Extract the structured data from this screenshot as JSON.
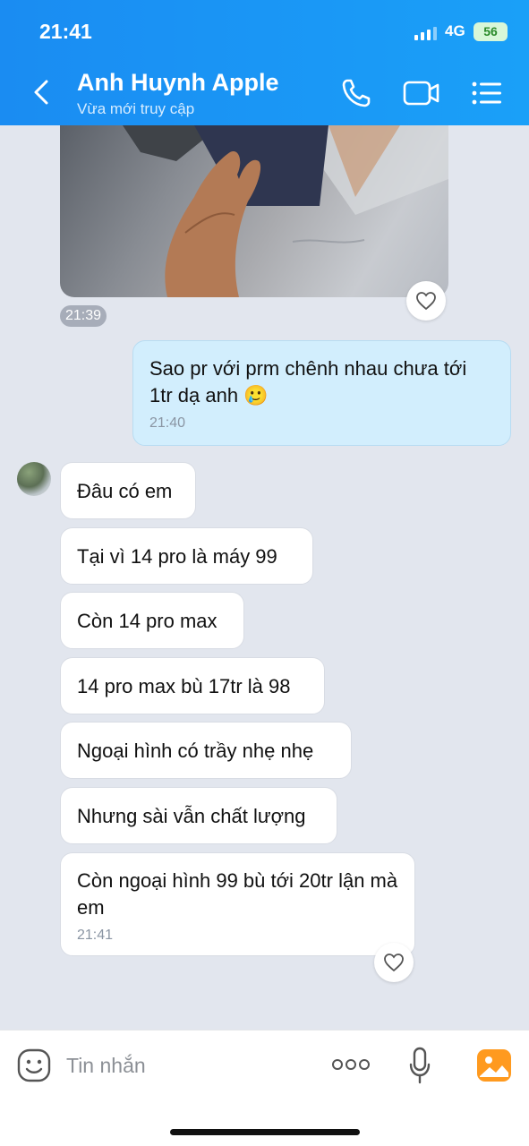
{
  "status_bar": {
    "time": "21:41",
    "network": "4G",
    "battery": "56"
  },
  "header": {
    "title": "Anh Huynh Apple",
    "subtitle": "Vừa mới truy cập"
  },
  "photo_message": {
    "time": "21:39"
  },
  "outgoing": {
    "text": "Sao pr với prm chênh nhau chưa tới 1tr dạ anh 🥲",
    "time": "21:40"
  },
  "incoming": [
    {
      "text": "Đâu có em"
    },
    {
      "text": "Tại vì 14 pro là máy 99"
    },
    {
      "text": "Còn 14 pro max"
    },
    {
      "text": "14 pro max bù 17tr là 98"
    },
    {
      "text": "Ngoại hình có trầy nhẹ nhẹ"
    },
    {
      "text": "Nhưng sài vẫn chất lượng"
    },
    {
      "text": "Còn ngoại hình 99 bù tới 20tr lận mà em",
      "time": "21:41"
    }
  ],
  "input": {
    "placeholder": "Tin nhắn"
  },
  "icons": [
    "back-arrow-icon",
    "phone-icon",
    "video-call-icon",
    "menu-icon",
    "heart-icon",
    "sticker-icon",
    "more-icon",
    "microphone-icon",
    "image-icon"
  ],
  "colors": {
    "header": "#1a8cf2",
    "outgoing_bubble": "#d2eefd",
    "background": "#e2e6ee",
    "image_icon": "#ff9a1f"
  }
}
